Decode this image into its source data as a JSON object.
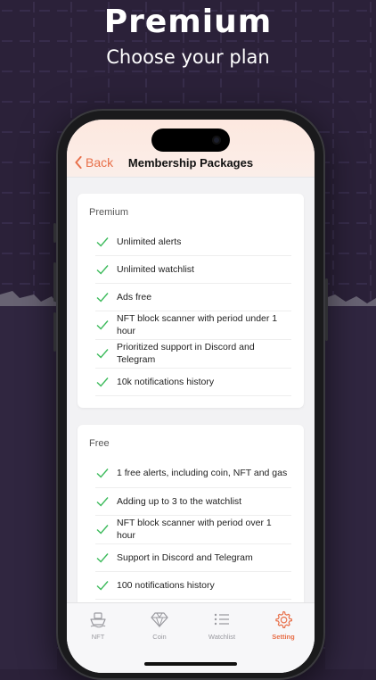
{
  "hero": {
    "title": "Premium",
    "subtitle": "Choose your plan"
  },
  "nav": {
    "back_label": "Back",
    "title": "Membership Packages"
  },
  "plans": [
    {
      "name": "Premium",
      "features": [
        "Unlimited alerts",
        "Unlimited watchlist",
        "Ads free",
        "NFT block scanner with period under 1 hour",
        "Prioritized support in Discord and Telegram",
        "10k notifications history"
      ]
    },
    {
      "name": "Free",
      "features": [
        "1 free alerts, including coin, NFT and gas",
        "Adding up to 3 to the watchlist",
        "NFT block scanner with period over 1 hour",
        "Support in Discord and Telegram",
        "100 notifications history"
      ]
    }
  ],
  "tabs": [
    {
      "label": "NFT",
      "icon": "ship-icon",
      "active": false
    },
    {
      "label": "Coin",
      "icon": "diamond-icon",
      "active": false
    },
    {
      "label": "Watchlist",
      "icon": "list-icon",
      "active": false
    },
    {
      "label": "Setting",
      "icon": "gear-icon",
      "active": true
    }
  ],
  "colors": {
    "accent": "#e8704a",
    "check": "#3dbb5c",
    "background": "#2b2139"
  }
}
